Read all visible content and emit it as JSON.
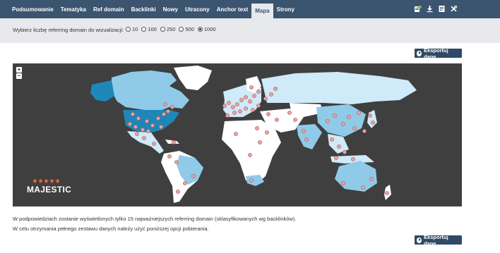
{
  "nav": {
    "tabs": [
      {
        "label": "Podsumowanie"
      },
      {
        "label": "Tematyka"
      },
      {
        "label": "Ref domain"
      },
      {
        "label": "Backlinki"
      },
      {
        "label": "Nowy"
      },
      {
        "label": "Utracony"
      },
      {
        "label": "Anchor text"
      },
      {
        "label": "Mapa",
        "active": true
      },
      {
        "label": "Strony"
      }
    ],
    "tools": [
      "bookmark-add-icon",
      "download-icon",
      "report-icon",
      "tools-icon"
    ]
  },
  "options": {
    "label": "Wybierz liczbę referring domain do wizualizacji:",
    "choices": [
      "10",
      "100",
      "250",
      "500",
      "1000"
    ],
    "selected": "1000"
  },
  "export_label": "Eksportuj dane",
  "map": {
    "zoom_in": "+",
    "zoom_out": "−",
    "logo": "MAJESTIC",
    "colors": {
      "ocean": "#3f3f3f",
      "land_default": "#ffffff",
      "land_light": "#cfeaf8",
      "land_mid": "#8fcbe8",
      "land_dark": "#1f87b8",
      "marker": "#e9a3a3"
    }
  },
  "notes": [
    "W podpowiedziach zostanie wyświetlonych tylko 15 najważniejszych referring domain (sklasyfikowanych wg backlinków).",
    "W celu otrzymania pełnego zestawu danych należy użyć poniższej opcji pobierania."
  ]
}
